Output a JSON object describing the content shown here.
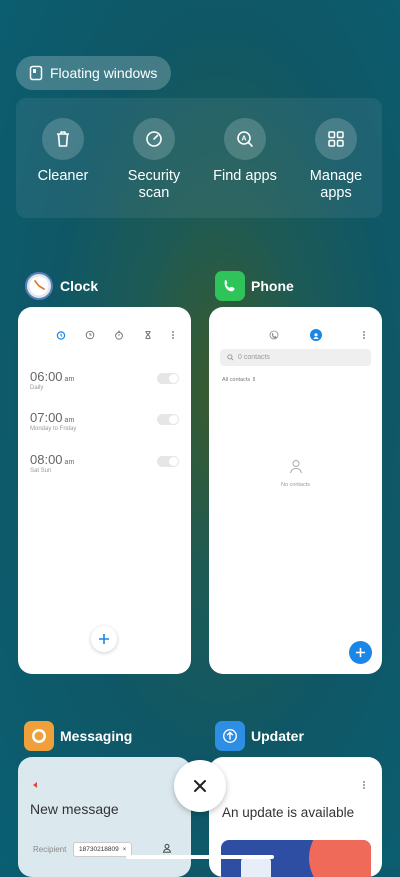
{
  "floating": {
    "label": "Floating windows"
  },
  "quick_actions": [
    {
      "label": "Cleaner",
      "icon": "trash-icon"
    },
    {
      "label": "Security scan",
      "icon": "gauge-icon"
    },
    {
      "label": "Find apps",
      "icon": "search-apps-icon"
    },
    {
      "label": "Manage apps",
      "icon": "grid-icon"
    }
  ],
  "apps": {
    "clock": {
      "title": "Clock",
      "alarms": [
        {
          "time": "06:00",
          "ampm": "am",
          "repeat": "Daily"
        },
        {
          "time": "07:00",
          "ampm": "am",
          "repeat": "Monday to Friday"
        },
        {
          "time": "08:00",
          "ampm": "am",
          "repeat": "Sat Sun"
        }
      ]
    },
    "phone": {
      "title": "Phone",
      "search_placeholder": "0 contacts",
      "filter": "All contacts",
      "empty": "No contacts"
    },
    "messaging": {
      "title": "Messaging",
      "heading": "New message",
      "recipient_label": "Recipient",
      "recipient_value": "18730218809"
    },
    "updater": {
      "title": "Updater",
      "heading": "An update is available"
    }
  },
  "colors": {
    "accent": "#1a87e8"
  }
}
